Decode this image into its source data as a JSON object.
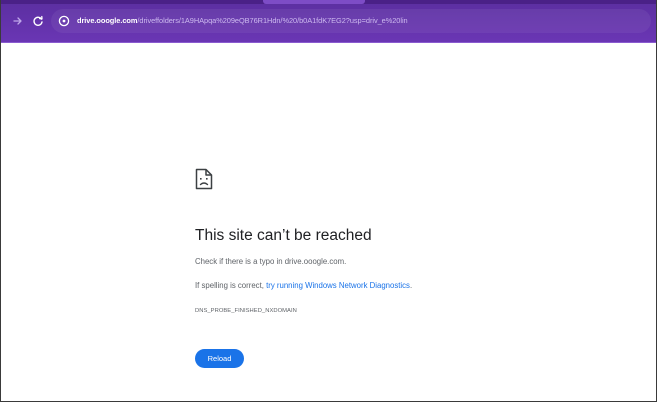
{
  "browser": {
    "url_host": "drive.ooogle.com",
    "url_path": "/driveffolders/1A9HApqa%209eQB76R1Hdn/%20/b0A1fdK7EG2?usp=driv_e%20lin",
    "icons": {
      "forward": "arrow-right-icon",
      "reload": "reload-icon",
      "site_info": "info-circle-icon"
    },
    "toolbar_color": "#6a36b4"
  },
  "error_page": {
    "icon": "sad-document-icon",
    "heading": "This site can’t be reached",
    "check_text": "Check if there is a typo in drive.ooogle.com.",
    "spelling_prefix": "If spelling is correct, ",
    "diagnostics_link": "try running Windows Network Diagnostics",
    "spelling_suffix": ".",
    "error_code": "DNS_PROBE_FINISHED_NXDOMAIN",
    "reload_label": "Reload",
    "accent_color": "#1a73e8"
  }
}
